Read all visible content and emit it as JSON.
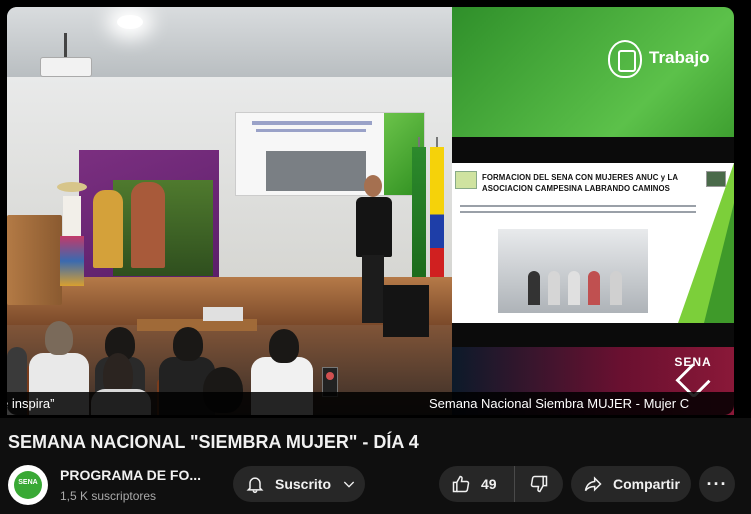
{
  "video": {
    "ticker_left": "e inspira”",
    "ticker_right": "Semana Nacional Siembra MUJER - Mujer C",
    "panel_brand": "Trabajo",
    "slide_title": "FORMACION DEL SENA  CON MUJERES ANUC y LA ASOCIACION CAMPESINA LABRANDO CAMINOS",
    "sena_logo_text": "SENA"
  },
  "title": "SEMANA NACIONAL \"SIEMBRA MUJER\" - DÍA 4",
  "channel": {
    "name": "PROGRAMA DE FO...",
    "subscribers": "1,5 K suscriptores",
    "avatar_text": "SENA"
  },
  "actions": {
    "subscribe_label": "Suscrito",
    "like_count": "49",
    "share_label": "Compartir",
    "more_label": "···"
  },
  "icons": {
    "bell": "bell-icon",
    "chevron": "chevron-down-icon",
    "like": "thumbs-up-icon",
    "dislike": "thumbs-down-icon",
    "share": "share-arrow-icon",
    "more": "more-horizontal-icon"
  },
  "colors": {
    "background": "#0f0f0f",
    "pill": "#272727",
    "text": "#f1f1f1",
    "muted": "#aaaaaa",
    "sena_green": "#39a935"
  }
}
